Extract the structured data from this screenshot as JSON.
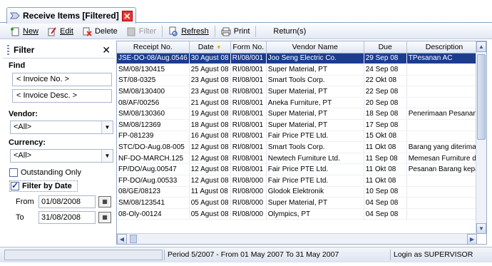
{
  "tab": {
    "title": "Receive Items [Filtered]"
  },
  "toolbar": {
    "new": "New",
    "edit": "Edit",
    "delete": "Delete",
    "filter": "Filter",
    "refresh": "Refresh",
    "print": "Print",
    "returns": "Return(s)"
  },
  "filter": {
    "title": "Filter",
    "find_label": "Find",
    "invoice_no": "< Invoice No. >",
    "invoice_desc": "< Invoice Desc. >",
    "vendor_label": "Vendor:",
    "vendor_value": "<All>",
    "currency_label": "Currency:",
    "currency_value": "<All>",
    "outstanding_only": "Outstanding Only",
    "outstanding_checked": false,
    "filter_by_date": "Filter by Date",
    "filter_by_date_checked": true,
    "from_label": "From",
    "from_value": "01/08/2008",
    "to_label": "To",
    "to_value": "31/08/2008"
  },
  "grid": {
    "columns": [
      "Receipt No.",
      "Date",
      "Form No.",
      "Vendor Name",
      "Due",
      "Description"
    ],
    "selected_row": 0,
    "rows": [
      [
        "JSE-DO-08/Aug.0546",
        "30 Agust 08",
        "RI/08/001",
        "Joo Seng Electric Co.",
        "29 Sep 08",
        "TPesanan AC"
      ],
      [
        "SM/08/130415",
        "25 Agust 08",
        "RI/08/001",
        "Super Material, PT",
        "24 Sep 08",
        ""
      ],
      [
        "ST/08-0325",
        "23 Agust 08",
        "RI/08/001",
        "Smart Tools Corp.",
        "22 Okt 08",
        ""
      ],
      [
        "SM/08/130400",
        "23 Agust 08",
        "RI/08/001",
        "Super Material, PT",
        "22 Sep 08",
        ""
      ],
      [
        "08/AF/00256",
        "21 Agust 08",
        "RI/08/001",
        "Aneka Furniture, PT",
        "20 Sep 08",
        ""
      ],
      [
        "SM/08/130360",
        "19 Agust 08",
        "RI/08/001",
        "Super Material, PT",
        "18 Sep 08",
        "Penerimaan Pesanan"
      ],
      [
        "SM/08/12369",
        "18 Agust 08",
        "RI/08/001",
        "Super Material, PT",
        "17 Sep 08",
        ""
      ],
      [
        "FP-081239",
        "16 Agust 08",
        "RI/08/001",
        "Fair Price PTE Ltd.",
        "15 Okt 08",
        ""
      ],
      [
        "STC/DO-Aug.08-005",
        "12 Agust 08",
        "RI/08/001",
        "Smart Tools Corp.",
        "11 Okt 08",
        "Barang yang diterima"
      ],
      [
        "NF-DO-MARCH.125",
        "12 Agust 08",
        "RI/08/001",
        "Newtech Furniture Ltd.",
        "11 Sep 08",
        "Memesan Furniture da"
      ],
      [
        "FP/DO/Aug.00547",
        "12 Agust 08",
        "RI/08/001",
        "Fair Price PTE Ltd.",
        "11 Okt 08",
        "Pesanan Barang kepa"
      ],
      [
        "FP-DO/Aug.00533",
        "12 Agust 08",
        "RI/08/000",
        "Fair Price PTE Ltd.",
        "11 Okt 08",
        ""
      ],
      [
        "08/GE/08123",
        "11 Agust 08",
        "RI/08/000",
        "Glodok Elektronik",
        "10 Sep 08",
        ""
      ],
      [
        "SM/08/123541",
        "05 Agust 08",
        "RI/08/000",
        "Super Material, PT",
        "04 Sep 08",
        ""
      ],
      [
        "08-Oly-00124",
        "05 Agust 08",
        "RI/08/000",
        "Olympics, PT",
        "04 Sep 08",
        ""
      ]
    ]
  },
  "status": {
    "period": "Period 5/2007 - From 01 May 2007 To 31 May 2007",
    "login": "Login as SUPERVISOR"
  },
  "colors": {
    "selection": "#1c3c8e",
    "close_red": "#e33333",
    "accent": "#8aa1c4"
  }
}
